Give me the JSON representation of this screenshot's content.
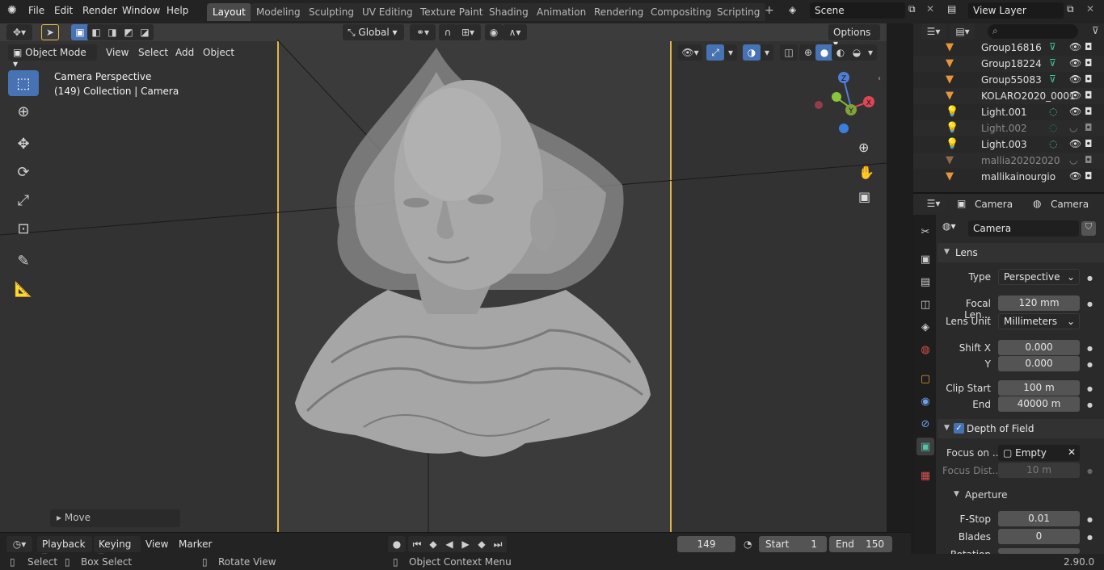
{
  "topbar": {
    "menus": [
      "File",
      "Edit",
      "Render",
      "Window",
      "Help"
    ],
    "workspaces": [
      "Layout",
      "Modeling",
      "Sculpting",
      "UV Editing",
      "Texture Paint",
      "Shading",
      "Animation",
      "Rendering",
      "Compositing",
      "Scripting"
    ],
    "active_workspace": "Layout",
    "add_tab": "+",
    "scene": "Scene",
    "view_layer": "View Layer"
  },
  "viewport": {
    "mode": "Object Mode",
    "menus": [
      "View",
      "Select",
      "Add",
      "Object"
    ],
    "orientation": "Global",
    "options": "Options",
    "camera_title": "Camera Perspective",
    "camera_subtitle": "(149) Collection | Camera",
    "move_panel": "Move",
    "gizmo": {
      "z": "Z",
      "x": "X",
      "y": "Y"
    }
  },
  "timeline": {
    "menus": [
      "Playback",
      "Keying",
      "View",
      "Marker"
    ],
    "current_frame": "149",
    "start_label": "Start",
    "start_value": "1",
    "end_label": "End",
    "end_value": "150"
  },
  "statusbar": {
    "select": "Select",
    "box_select": "Box Select",
    "rotate_view": "Rotate View",
    "context_menu": "Object Context Menu",
    "version": "2.90.0"
  },
  "outliner": {
    "items": [
      {
        "name": "Group16816",
        "type": "mesh",
        "dim": false,
        "modifier": true
      },
      {
        "name": "Group18224",
        "type": "mesh",
        "dim": false,
        "modifier": true
      },
      {
        "name": "Group55083",
        "type": "mesh",
        "dim": false,
        "modifier": true
      },
      {
        "name": "KOLARO2020_0001",
        "type": "mesh",
        "dim": false,
        "modifier": false
      },
      {
        "name": "Light.001",
        "type": "light",
        "dim": false,
        "modifier": true
      },
      {
        "name": "Light.002",
        "type": "light",
        "dim": true,
        "modifier": true
      },
      {
        "name": "Light.003",
        "type": "light",
        "dim": false,
        "modifier": true
      },
      {
        "name": "mallia20202020",
        "type": "mesh",
        "dim": true,
        "modifier": false
      },
      {
        "name": "mallikainourgio",
        "type": "mesh",
        "dim": false,
        "modifier": false
      }
    ]
  },
  "properties": {
    "breadcrumb_object": "Camera",
    "breadcrumb_data": "Camera",
    "datablock": "Camera",
    "lens_section": "Lens",
    "type_label": "Type",
    "type_value": "Perspective",
    "focal_label": "Focal Len...",
    "focal_value": "120 mm",
    "lens_unit_label": "Lens Unit",
    "lens_unit_value": "Millimeters",
    "shift_x_label": "Shift X",
    "shift_x_value": "0.000",
    "shift_y_label": "Y",
    "shift_y_value": "0.000",
    "clip_start_label": "Clip Start",
    "clip_start_value": "100 m",
    "clip_end_label": "End",
    "clip_end_value": "40000 m",
    "dof_section": "Depth of Field",
    "focus_on_label": "Focus on ...",
    "focus_on_value": "Empty",
    "focus_dist_label": "Focus Dist...",
    "focus_dist_value": "10 m",
    "aperture_section": "Aperture",
    "fstop_label": "F-Stop",
    "fstop_value": "0.01",
    "blades_label": "Blades",
    "blades_value": "0",
    "rotation_label": "Rotation"
  },
  "colors": {
    "accent": "#4772b3",
    "camera_frame": "#e0b84a",
    "object_icon": "#e8953a",
    "modifier": "#41c79f"
  }
}
